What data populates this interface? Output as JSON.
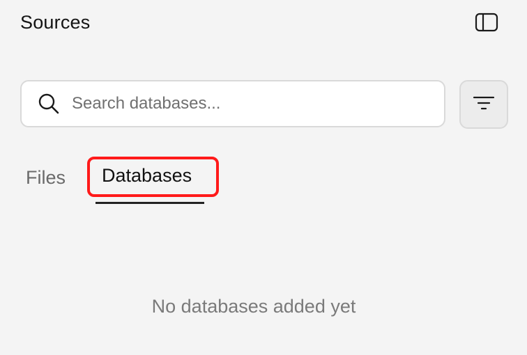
{
  "panel": {
    "title": "Sources"
  },
  "toolbar": {
    "toggle_icon": "sidebar-toggle-icon",
    "filter_icon": "filter-icon"
  },
  "search": {
    "placeholder": "Search databases...",
    "value": "",
    "icon": "search-icon"
  },
  "tabs": [
    {
      "label": "Files",
      "active": false
    },
    {
      "label": "Databases",
      "active": true
    }
  ],
  "empty_state": {
    "message": "No databases added yet"
  },
  "colors": {
    "background": "#f4f4f4",
    "highlight": "#ff1a1a",
    "active_tab_underline": "#222222",
    "inactive_tab_text": "#6a6a6a"
  }
}
